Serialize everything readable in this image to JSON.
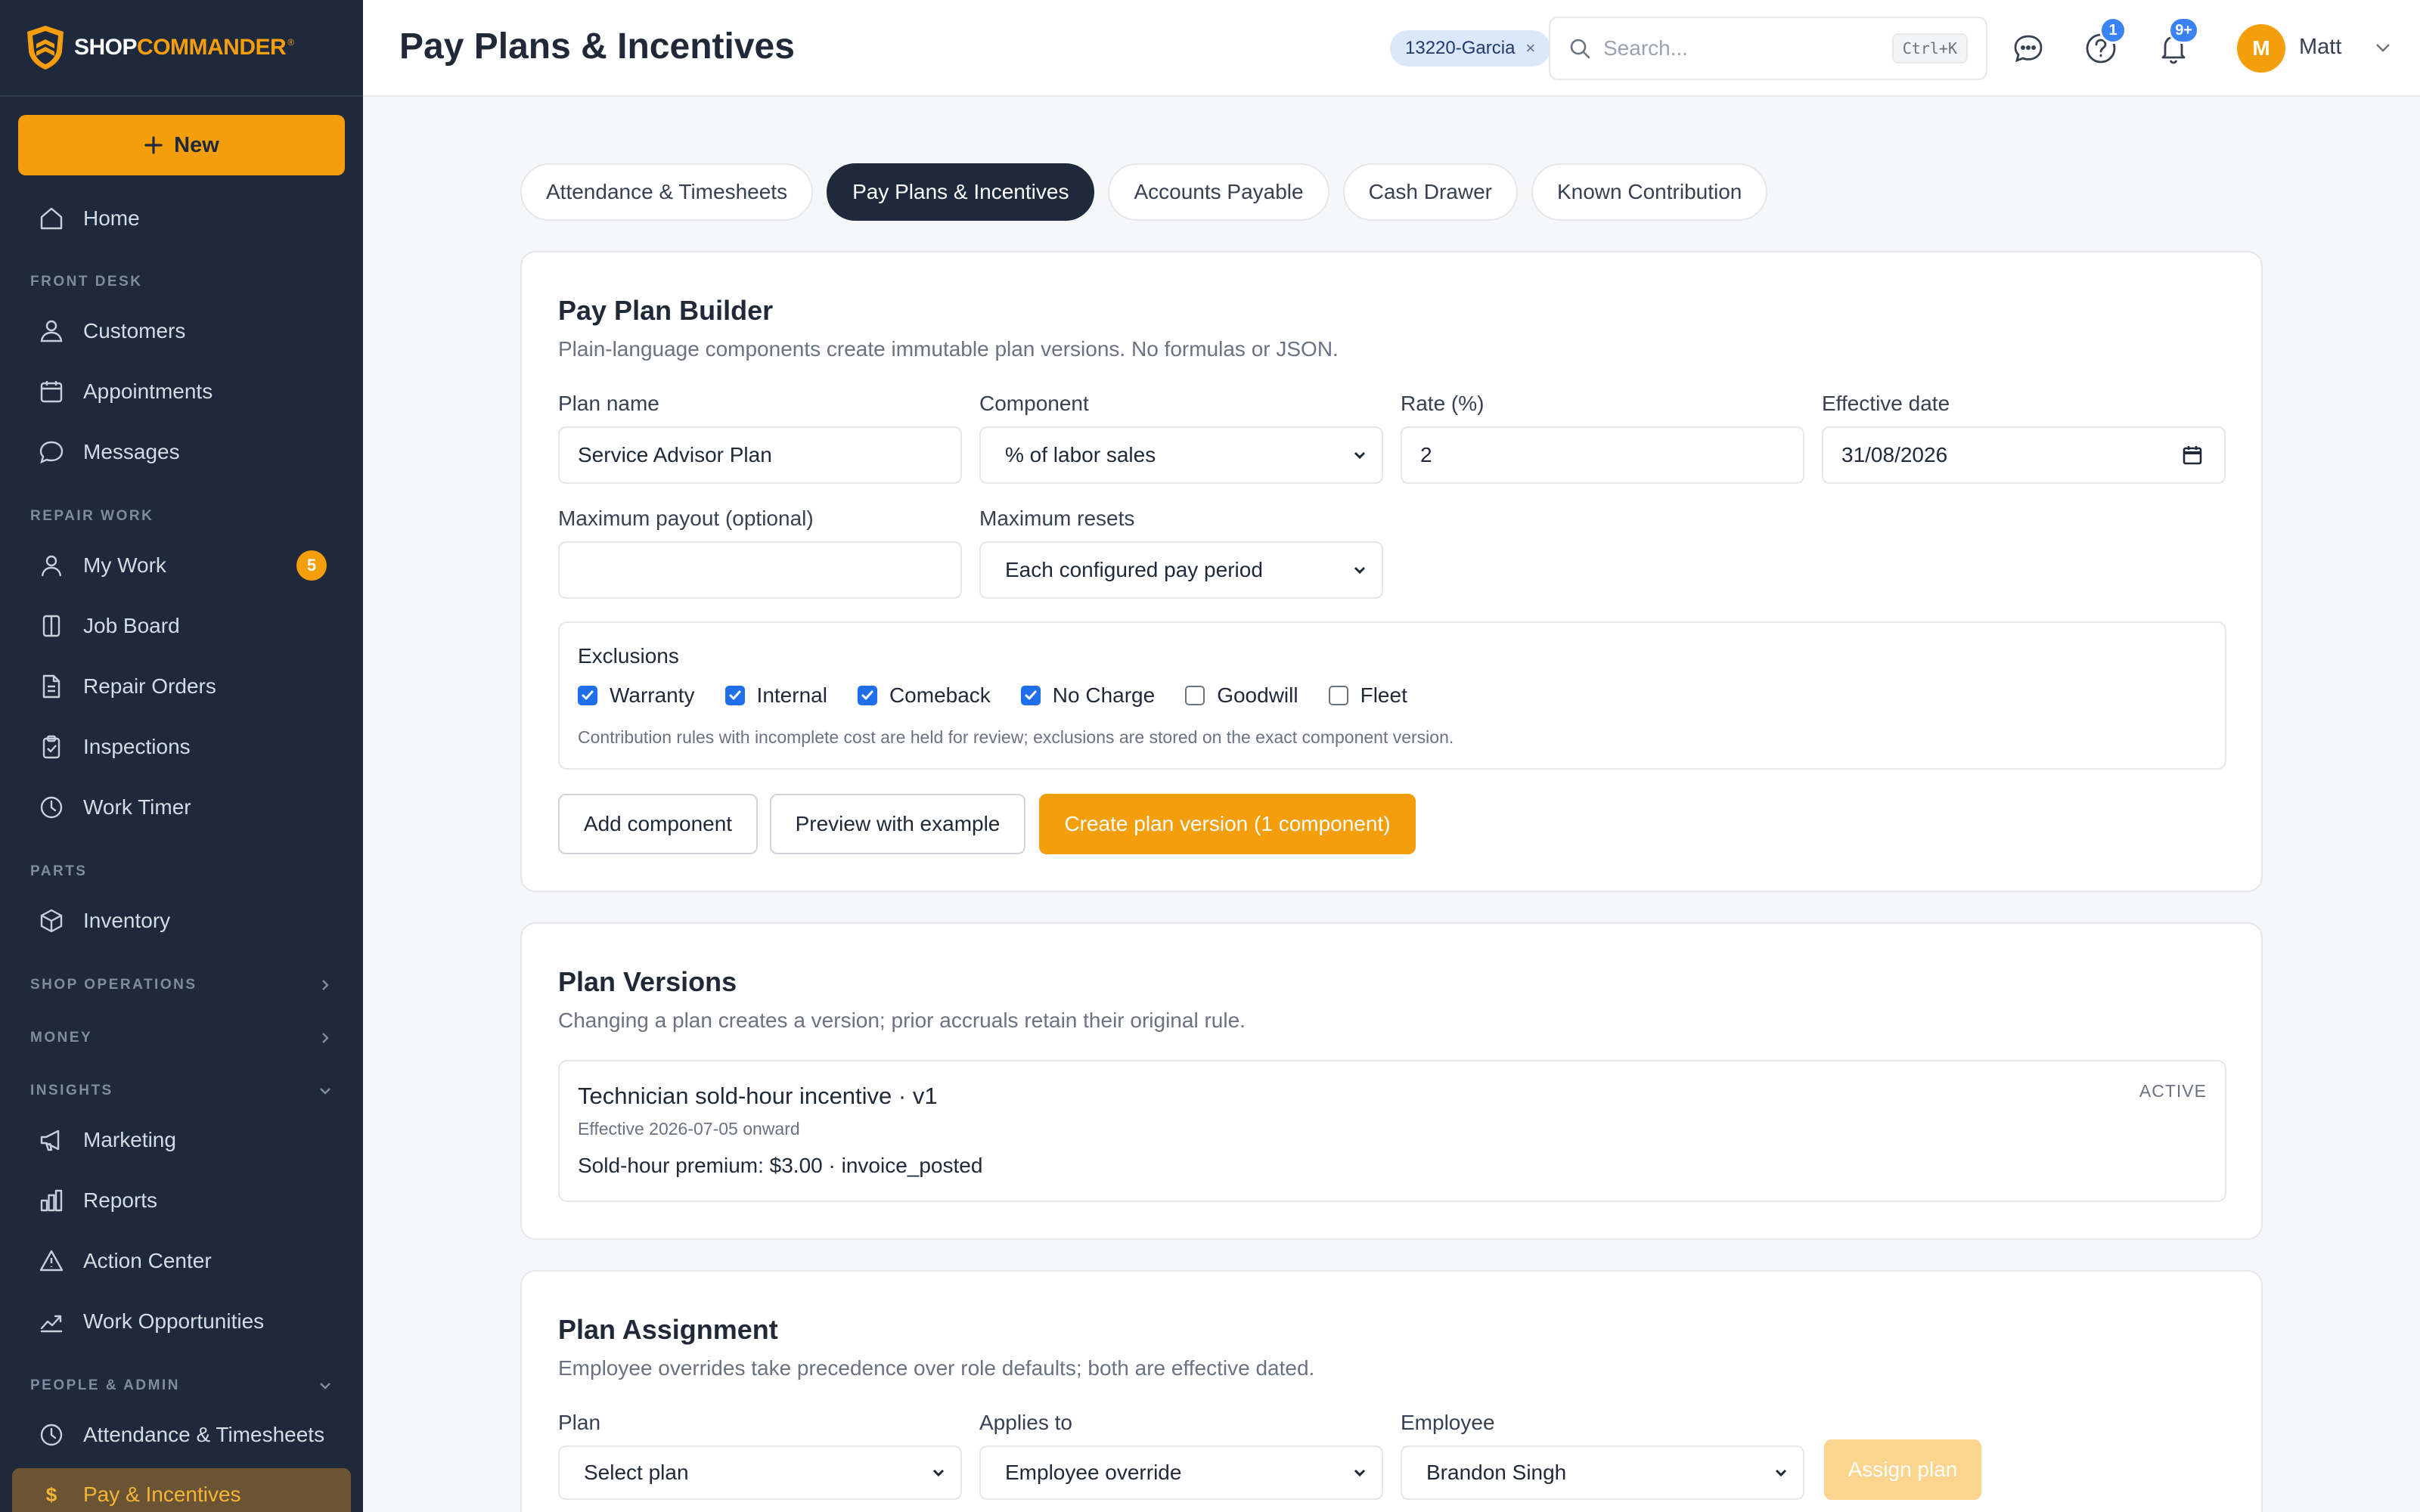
{
  "brand": {
    "name_white": "SHOP",
    "name_orange": "COMMANDER",
    "reg": "®"
  },
  "sidebar": {
    "new_label": "New",
    "home": "Home",
    "sections": {
      "front_desk": "FRONT DESK",
      "repair_work": "REPAIR WORK",
      "parts": "PARTS",
      "shop_operations": "SHOP OPERATIONS",
      "money": "MONEY",
      "insights": "INSIGHTS",
      "people_admin": "PEOPLE & ADMIN"
    },
    "items": {
      "customers": "Customers",
      "appointments": "Appointments",
      "messages": "Messages",
      "my_work": "My Work",
      "my_work_badge": "5",
      "job_board": "Job Board",
      "repair_orders": "Repair Orders",
      "inspections": "Inspections",
      "work_timer": "Work Timer",
      "inventory": "Inventory",
      "marketing": "Marketing",
      "reports": "Reports",
      "action_center": "Action Center",
      "work_opportunities": "Work Opportunities",
      "attendance": "Attendance & Timesheets",
      "pay_incentives": "Pay & Incentives"
    },
    "pay_icon_glyph": "$"
  },
  "header": {
    "title": "Pay Plans & Incentives",
    "chip": "13220-Garcia",
    "search_placeholder": "Search...",
    "shortcut": "Ctrl+K",
    "help_badge": "1",
    "notif_badge": "9+",
    "avatar_initial": "M",
    "user_name": "Matt"
  },
  "tabs": [
    "Attendance & Timesheets",
    "Pay Plans & Incentives",
    "Accounts Payable",
    "Cash Drawer",
    "Known Contribution"
  ],
  "builder": {
    "title": "Pay Plan Builder",
    "subtitle": "Plain-language components create immutable plan versions. No formulas or JSON.",
    "plan_name_label": "Plan name",
    "plan_name_value": "Service Advisor Plan",
    "component_label": "Component",
    "component_value": "% of labor sales",
    "rate_label": "Rate (%)",
    "rate_value": "2",
    "date_label": "Effective date",
    "date_value": "31/08/2026",
    "max_payout_label": "Maximum payout (optional)",
    "max_payout_value": "",
    "max_resets_label": "Maximum resets",
    "max_resets_value": "Each configured pay period",
    "exclusions_title": "Exclusions",
    "exclusions": [
      {
        "label": "Warranty",
        "checked": true
      },
      {
        "label": "Internal",
        "checked": true
      },
      {
        "label": "Comeback",
        "checked": true
      },
      {
        "label": "No Charge",
        "checked": true
      },
      {
        "label": "Goodwill",
        "checked": false
      },
      {
        "label": "Fleet",
        "checked": false
      }
    ],
    "exclusions_note": "Contribution rules with incomplete cost are held for review; exclusions are stored on the exact component version.",
    "add_component": "Add component",
    "preview": "Preview with example",
    "create": "Create plan version (1 component)"
  },
  "versions": {
    "title": "Plan Versions",
    "subtitle": "Changing a plan creates a version; prior accruals retain their original rule.",
    "item_name": "Technician sold-hour incentive · v1",
    "item_status": "ACTIVE",
    "item_effective": "Effective 2026-07-05 onward",
    "item_rule": "Sold-hour premium: $3.00 · invoice_posted"
  },
  "assignment": {
    "title": "Plan Assignment",
    "subtitle": "Employee overrides take precedence over role defaults; both are effective dated.",
    "plan_label": "Plan",
    "plan_value": "Select plan",
    "applies_label": "Applies to",
    "applies_value": "Employee override",
    "employee_label": "Employee",
    "employee_value": "Brandon Singh",
    "assign_button": "Assign plan"
  },
  "colors": {
    "sidebar": "#1e2a3b",
    "accent": "#f59e0b",
    "active_nav_bg": "#6b5433",
    "badge_blue": "#3b82f6"
  }
}
